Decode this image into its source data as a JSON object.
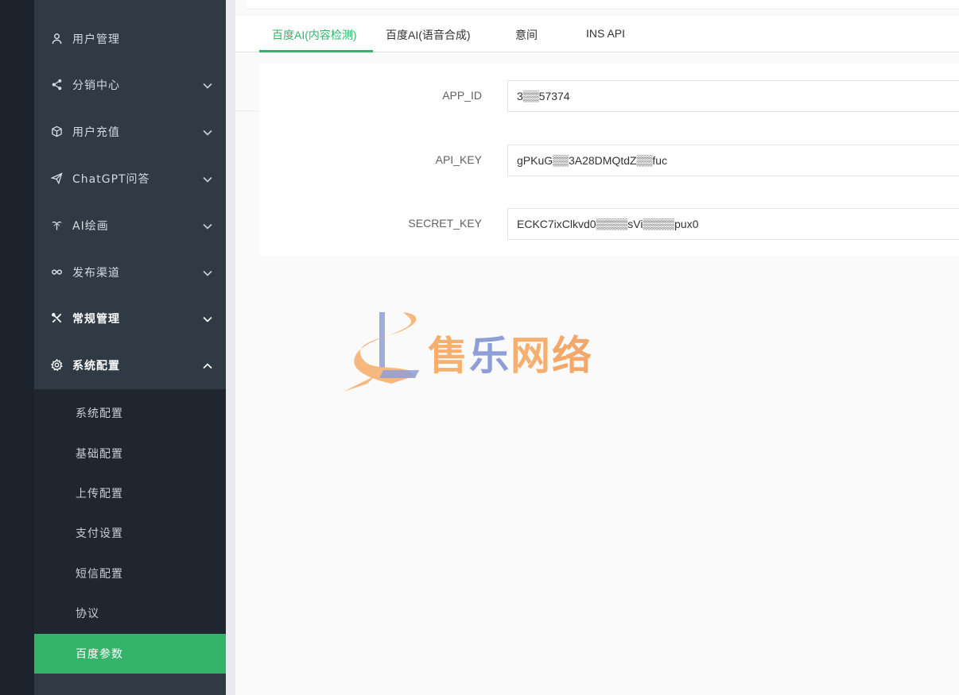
{
  "sidebar": {
    "items": [
      {
        "label": "用户管理",
        "icon": "user-icon",
        "expandable": false
      },
      {
        "label": "分销中心",
        "icon": "share-icon",
        "expandable": true
      },
      {
        "label": "用户充值",
        "icon": "box-icon",
        "expandable": true
      },
      {
        "label": "ChatGPT问答",
        "icon": "send-icon",
        "expandable": true
      },
      {
        "label": "AI绘画",
        "icon": "palm-icon",
        "expandable": true
      },
      {
        "label": "发布渠道",
        "icon": "link-icon",
        "expandable": true
      },
      {
        "label": "常规管理",
        "icon": "tools-icon",
        "expandable": true
      },
      {
        "label": "系统配置",
        "icon": "gear-icon",
        "expandable": true,
        "expanded": true
      }
    ],
    "submenu": [
      {
        "label": "系统配置"
      },
      {
        "label": "基础配置"
      },
      {
        "label": "上传配置"
      },
      {
        "label": "支付设置"
      },
      {
        "label": "短信配置"
      },
      {
        "label": "协议"
      },
      {
        "label": "百度参数",
        "active": true
      }
    ]
  },
  "tabs": [
    {
      "label": "百度AI(内容检测)",
      "active": true
    },
    {
      "label": "百度AI(语音合成)"
    },
    {
      "label": "意间"
    },
    {
      "label": "INS API"
    }
  ],
  "form": {
    "fields": [
      {
        "label": "APP_ID",
        "value": "3▒▒57374"
      },
      {
        "label": "API_KEY",
        "value": "gPKuG▒▒3A28DMQtdZ▒▒fuc"
      },
      {
        "label": "SECRET_KEY",
        "value": "ECKC7ixClkvd0▒▒▒▒sVi▒▒▒▒pux0"
      }
    ]
  },
  "watermark": {
    "text": "售乐网络",
    "colors": [
      "#f5b070",
      "#8e9ed6",
      "#f5b070",
      "#f3a86a"
    ]
  },
  "colors": {
    "accent": "#35b36b",
    "sidebar_bg": "#2f3a45",
    "submenu_bg": "#1f2630"
  }
}
